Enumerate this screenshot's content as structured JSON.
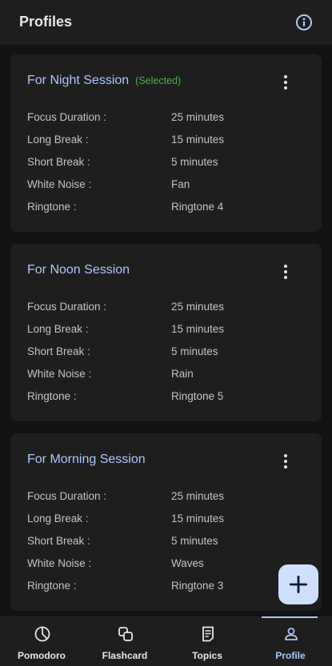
{
  "appbar": {
    "title": "Profiles",
    "info_icon": "info-circle-icon"
  },
  "profiles": [
    {
      "title": "For Night Session",
      "selected_label": "(Selected)",
      "rows": [
        {
          "label": "Focus Duration :",
          "value": "25 minutes"
        },
        {
          "label": "Long Break :",
          "value": "15 minutes"
        },
        {
          "label": "Short Break :",
          "value": "5 minutes"
        },
        {
          "label": "White Noise :",
          "value": "Fan"
        },
        {
          "label": "Ringtone :",
          "value": "Ringtone 4"
        }
      ]
    },
    {
      "title": "For Noon Session",
      "selected_label": "",
      "rows": [
        {
          "label": "Focus Duration :",
          "value": "25 minutes"
        },
        {
          "label": "Long Break :",
          "value": "15 minutes"
        },
        {
          "label": "Short Break :",
          "value": "5 minutes"
        },
        {
          "label": "White Noise :",
          "value": "Rain"
        },
        {
          "label": "Ringtone :",
          "value": "Ringtone 5"
        }
      ]
    },
    {
      "title": "For Morning Session",
      "selected_label": "",
      "rows": [
        {
          "label": "Focus Duration :",
          "value": "25 minutes"
        },
        {
          "label": "Long Break :",
          "value": "15 minutes"
        },
        {
          "label": "Short Break :",
          "value": "5 minutes"
        },
        {
          "label": "White Noise :",
          "value": "Waves"
        },
        {
          "label": "Ringtone :",
          "value": "Ringtone 3"
        }
      ]
    }
  ],
  "fab": {
    "icon": "plus-icon"
  },
  "bottom_nav": {
    "active": "Profile",
    "items": [
      {
        "label": "Pomodoro",
        "icon": "pie-chart-icon"
      },
      {
        "label": "Flashcard",
        "icon": "flashcard-icon"
      },
      {
        "label": "Topics",
        "icon": "document-icon"
      },
      {
        "label": "Profile",
        "icon": "person-icon"
      }
    ]
  },
  "colors": {
    "background": "#121212",
    "surface": "#1e1e1e",
    "accent": "#aec6ff",
    "selected": "#4caf50",
    "fab": "#cfe0ff"
  }
}
